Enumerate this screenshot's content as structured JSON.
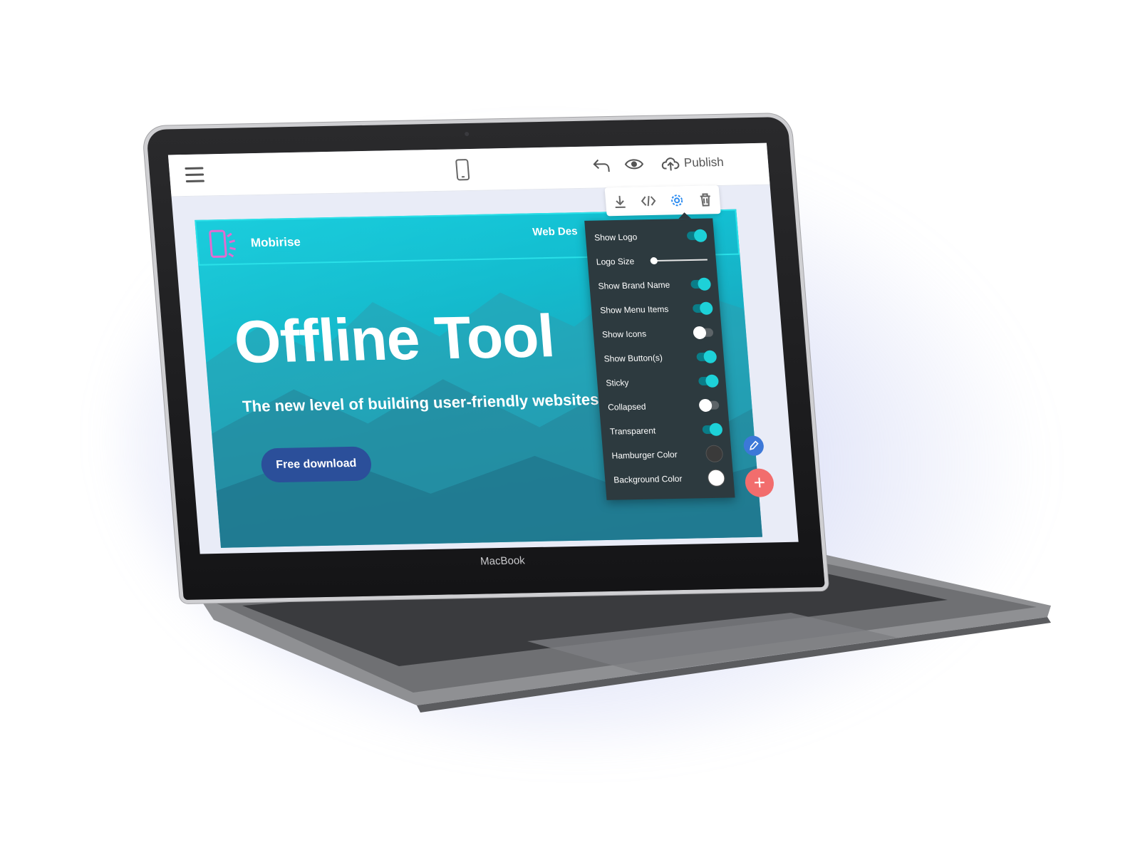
{
  "device": {
    "brand_label": "MacBook"
  },
  "builder": {
    "topbar": {
      "publish_label": "Publish",
      "icons": [
        "hamburger-icon",
        "mobile-device-icon",
        "undo-icon",
        "preview-eye-icon",
        "cloud-upload-icon"
      ]
    },
    "block_toolbar": {
      "icons": [
        "download-icon",
        "code-icon",
        "gear-icon",
        "trash-icon"
      ]
    }
  },
  "hero": {
    "brand_name": "Mobirise",
    "nav_item": "Web Des",
    "title": "Offline Tool",
    "subtitle": "The new level of building user-friendly websites!",
    "button_label": "Free download"
  },
  "settings": {
    "items": [
      {
        "label": "Show Logo",
        "control": "toggle",
        "on": true
      },
      {
        "label": "Logo Size",
        "control": "slider",
        "value": 0
      },
      {
        "label": "Show Brand Name",
        "control": "toggle",
        "on": true
      },
      {
        "label": "Show Menu Items",
        "control": "toggle",
        "on": true
      },
      {
        "label": "Show Icons",
        "control": "toggle",
        "on": false
      },
      {
        "label": "Show Button(s)",
        "control": "toggle",
        "on": true
      },
      {
        "label": "Sticky",
        "control": "toggle",
        "on": true
      },
      {
        "label": "Collapsed",
        "control": "toggle",
        "on": false
      },
      {
        "label": "Transparent",
        "control": "toggle",
        "on": true
      },
      {
        "label": "Hamburger Color",
        "control": "color",
        "color": "#3a3a3a"
      },
      {
        "label": "Background Color",
        "control": "color",
        "color": "#ffffff"
      }
    ]
  },
  "colors": {
    "accent": "#1dd1d8",
    "panel_bg": "#2d3a3f",
    "button_bg": "#2b4f9a",
    "fab_add": "#f26d6d",
    "fab_edit": "#3c78d8"
  }
}
